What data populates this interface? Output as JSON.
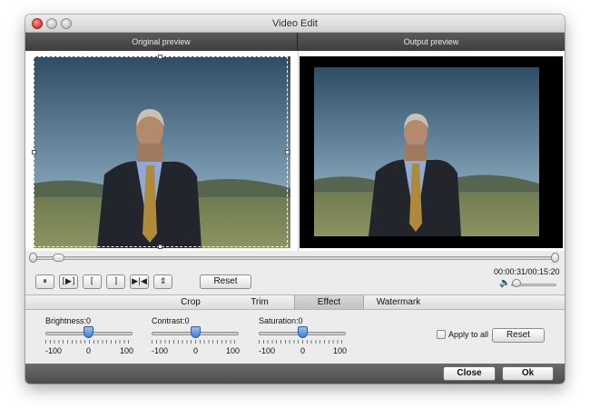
{
  "window": {
    "title": "Video Edit"
  },
  "preview": {
    "original_label": "Original preview",
    "output_label": "Output preview"
  },
  "playback": {
    "buttons": [
      {
        "name": "pause-button",
        "glyph": "⏸"
      },
      {
        "name": "play-frame-button",
        "glyph": "[▶]"
      },
      {
        "name": "set-start-button",
        "glyph": "["
      },
      {
        "name": "set-end-button",
        "glyph": "]"
      },
      {
        "name": "skip-end-button",
        "glyph": "▶|◀"
      },
      {
        "name": "split-button",
        "glyph": "⇕"
      }
    ],
    "reset_label": "Reset",
    "timecode": "00:00:31/00:15:20",
    "seek_position": 0.05,
    "volume": 0.05,
    "volume_icon": "🔈"
  },
  "tabs": [
    {
      "label": "Crop",
      "active": false
    },
    {
      "label": "Trim",
      "active": false
    },
    {
      "label": "Effect",
      "active": true
    },
    {
      "label": "Watermark",
      "active": false
    }
  ],
  "effect": {
    "brightness": {
      "label": "Brightness:0",
      "value": 0,
      "min_label": "-100",
      "mid_label": "0",
      "max_label": "100"
    },
    "contrast": {
      "label": "Contrast:0",
      "value": 0,
      "min_label": "-100",
      "mid_label": "0",
      "max_label": "100"
    },
    "saturation": {
      "label": "Saturation:0",
      "value": 0,
      "min_label": "-100",
      "mid_label": "0",
      "max_label": "100"
    },
    "apply_to_all_label": "Apply to all",
    "apply_to_all_checked": false,
    "reset_label": "Reset"
  },
  "footer": {
    "close_label": "Close",
    "ok_label": "Ok"
  },
  "colors": {
    "header_dark": "#4a4a4a",
    "slider_knob": "#3f7ed5",
    "volume_icon": "#3a6fc4"
  }
}
